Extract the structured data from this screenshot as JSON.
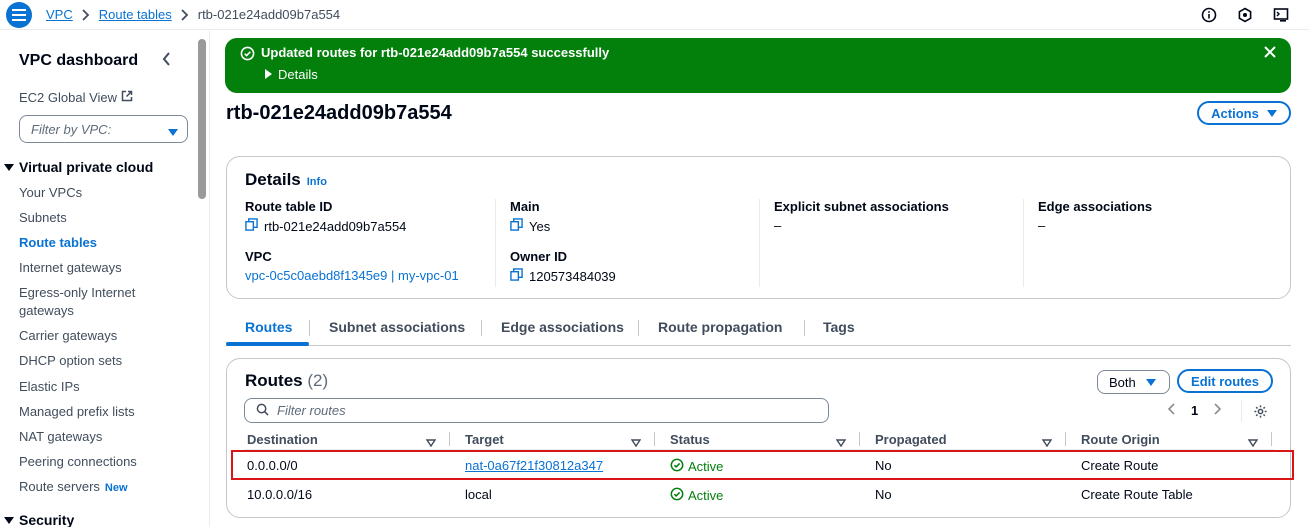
{
  "breadcrumb": {
    "root": "VPC",
    "parent": "Route tables",
    "current": "rtb-021e24add09b7a554"
  },
  "top_icons": [
    "info-icon",
    "notifications-icon",
    "cloudshell-icon"
  ],
  "sidebar": {
    "title": "VPC dashboard",
    "ec2_global_view": "EC2 Global View",
    "filter_placeholder": "Filter by VPC:",
    "section_vpc": "Virtual private cloud",
    "items": [
      {
        "label": "Your VPCs"
      },
      {
        "label": "Subnets"
      },
      {
        "label": "Route tables"
      },
      {
        "label": "Internet gateways"
      },
      {
        "label": "Egress-only Internet gateways"
      },
      {
        "label": "Carrier gateways"
      },
      {
        "label": "DHCP option sets"
      },
      {
        "label": "Elastic IPs"
      },
      {
        "label": "Managed prefix lists"
      },
      {
        "label": "NAT gateways"
      },
      {
        "label": "Peering connections"
      },
      {
        "label": "Route servers",
        "badge": "New"
      }
    ],
    "section_security": "Security"
  },
  "flash": {
    "message": "Updated routes for rtb-021e24add09b7a554 successfully",
    "details": "Details",
    "color": "#037f0c"
  },
  "page": {
    "title": "rtb-021e24add09b7a554",
    "actions": "Actions"
  },
  "details": {
    "header": "Details",
    "info": "Info",
    "route_table_id_label": "Route table ID",
    "route_table_id": "rtb-021e24add09b7a554",
    "vpc_label": "VPC",
    "vpc": "vpc-0c5c0aebd8f1345e9 | my-vpc-01",
    "main_label": "Main",
    "main": "Yes",
    "owner_label": "Owner ID",
    "owner": "120573484039",
    "explicit_label": "Explicit subnet associations",
    "explicit": "–",
    "edge_label": "Edge associations",
    "edge": "–"
  },
  "tabs": [
    "Routes",
    "Subnet associations",
    "Edge associations",
    "Route propagation",
    "Tags"
  ],
  "routes": {
    "header": "Routes",
    "count": "(2)",
    "both": "Both",
    "edit": "Edit routes",
    "filter_placeholder": "Filter routes",
    "page": "1",
    "columns": [
      "Destination",
      "Target",
      "Status",
      "Propagated",
      "Route Origin"
    ],
    "rows": [
      {
        "destination": "0.0.0.0/0",
        "target": "nat-0a67f21f30812a347",
        "status": "Active",
        "propagated": "No",
        "origin": "Create Route"
      },
      {
        "destination": "10.0.0.0/16",
        "target": "local",
        "status": "Active",
        "propagated": "No",
        "origin": "Create Route Table"
      }
    ]
  },
  "colors": {
    "accent": "#0972d3",
    "success": "#037f0c",
    "highlight": "#d91515"
  }
}
